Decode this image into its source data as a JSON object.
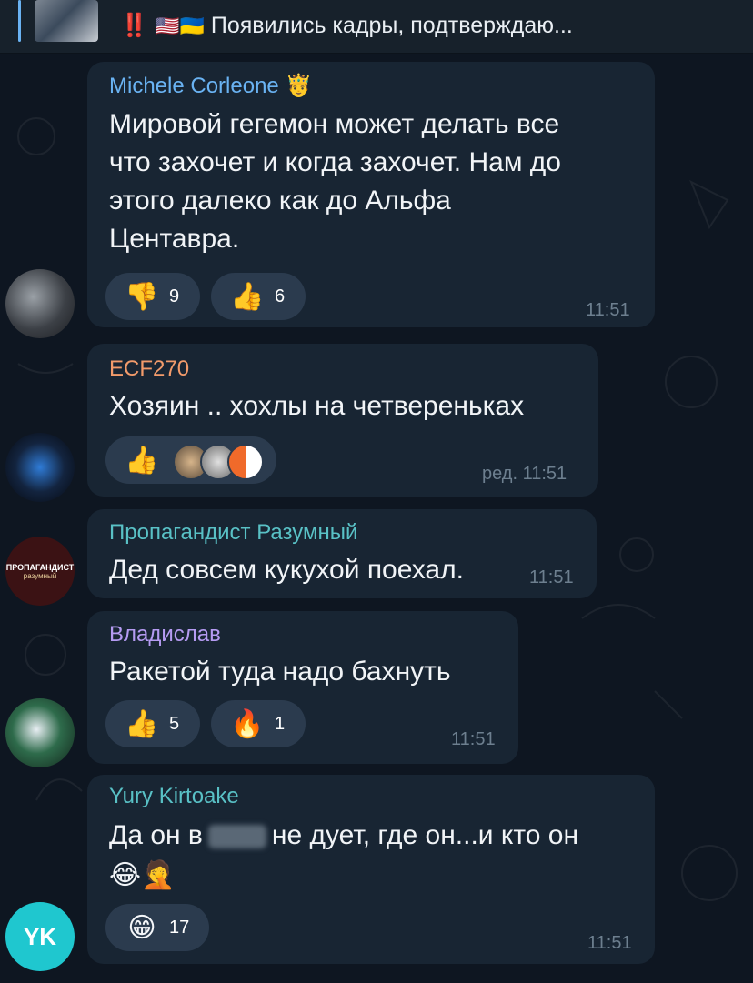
{
  "pinned": {
    "marks": "‼️",
    "flags": "🇺🇸🇺🇦",
    "text": "Появились кадры, подтверждаю..."
  },
  "messages": [
    {
      "author": "Michele Corleone",
      "author_badge": "🤴",
      "author_color": "#6ab3f3",
      "text_lines": [
        "Мировой гегемон может делать все",
        "что захочет и когда захочет. Нам до",
        "этого далеко как до Альфа",
        "Центавра."
      ],
      "reactions": [
        {
          "emoji": "👎",
          "count": "9"
        },
        {
          "emoji": "👍",
          "count": "6"
        }
      ],
      "time": "11:51"
    },
    {
      "author": "ECF270",
      "author_color": "#f29b6b",
      "text": "Хозяин .. хохлы на четвереньках",
      "reactions": [
        {
          "emoji": "👍",
          "count": ""
        }
      ],
      "time": "ред. 11:51"
    },
    {
      "author": "Пропагандист Разумный",
      "author_color": "#59c1c6",
      "avatar_title": "ПРОПАГАНДИСТ",
      "avatar_sub": "разумный",
      "text": "Дед совсем кукухой поехал.",
      "time": "11:51"
    },
    {
      "author": "Владислав",
      "author_color": "#b59bf2",
      "text": "Ракетой туда надо бахнуть",
      "reactions": [
        {
          "emoji": "👍",
          "count": "5"
        },
        {
          "emoji": "🔥",
          "count": "1"
        }
      ],
      "time": "11:51"
    },
    {
      "author": "Yury Kirtoake",
      "author_color": "#59c1c6",
      "avatar_initials": "YK",
      "text_before": "Да он в",
      "text_after": "не дует, где он...и кто он",
      "text_emoji": "😂🤦",
      "reactions": [
        {
          "emoji": "😁",
          "count": "17"
        }
      ],
      "time": "11:51"
    }
  ],
  "colors": {
    "background": "#0e1621",
    "bubble": "#182533",
    "reaction": "#2b3b4e",
    "time": "#6d7f8f"
  }
}
